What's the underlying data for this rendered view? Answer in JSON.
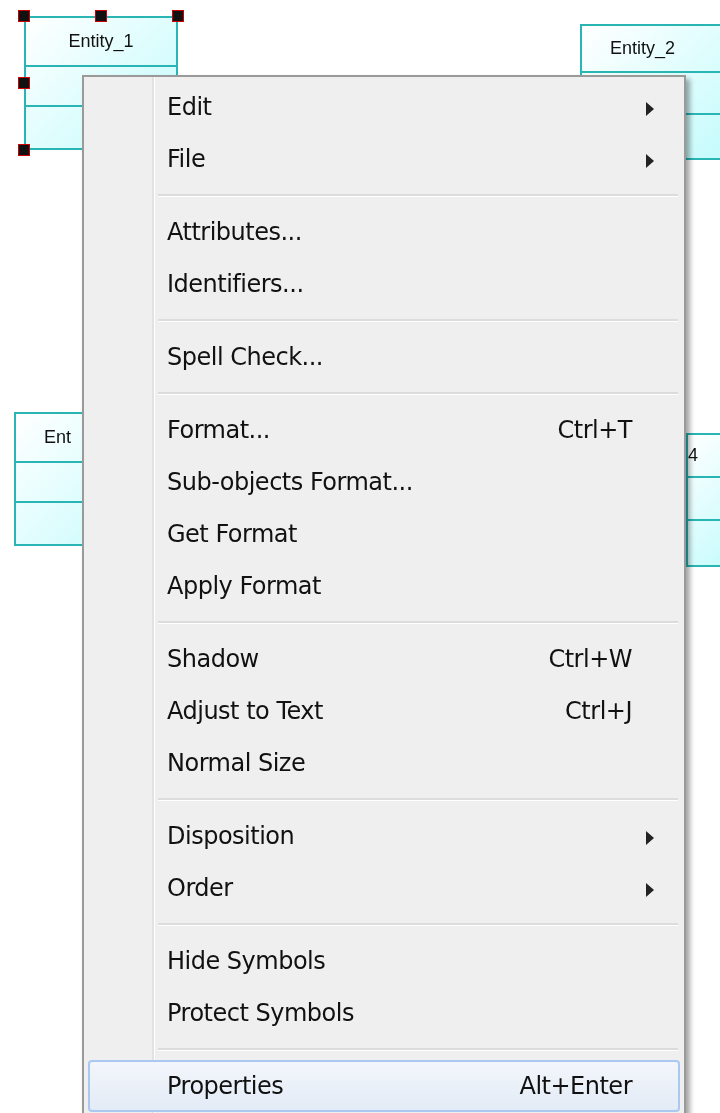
{
  "entities": [
    {
      "name": "Entity_1",
      "selected": true
    },
    {
      "name": "Entity_2",
      "selected": false
    },
    {
      "name": "Ent",
      "selected": false
    },
    {
      "name": "4",
      "selected": false
    }
  ],
  "context_menu": {
    "groups": [
      [
        {
          "label": "Edit",
          "submenu": true,
          "selected": false
        },
        {
          "label": "File",
          "submenu": true,
          "selected": false
        }
      ],
      [
        {
          "label": "Attributes...",
          "submenu": false,
          "selected": false
        },
        {
          "label": "Identifiers...",
          "submenu": false,
          "selected": false
        }
      ],
      [
        {
          "label": "Spell Check...",
          "submenu": false,
          "selected": false
        }
      ],
      [
        {
          "label": "Format...",
          "shortcut": "Ctrl+T",
          "submenu": false,
          "selected": false
        },
        {
          "label": "Sub-objects Format...",
          "submenu": false,
          "selected": false
        },
        {
          "label": "Get Format",
          "submenu": false,
          "selected": false
        },
        {
          "label": "Apply Format",
          "submenu": false,
          "selected": false
        }
      ],
      [
        {
          "label": "Shadow",
          "shortcut": "Ctrl+W",
          "submenu": false,
          "selected": false
        },
        {
          "label": "Adjust to Text",
          "shortcut": "Ctrl+J",
          "submenu": false,
          "selected": false
        },
        {
          "label": "Normal Size",
          "submenu": false,
          "selected": false
        }
      ],
      [
        {
          "label": "Disposition",
          "submenu": true,
          "selected": false
        },
        {
          "label": "Order",
          "submenu": true,
          "selected": false
        }
      ],
      [
        {
          "label": "Hide Symbols",
          "submenu": false,
          "selected": false
        },
        {
          "label": "Protect Symbols",
          "submenu": false,
          "selected": false
        }
      ],
      [
        {
          "label": "Properties",
          "shortcut": "Alt+Enter",
          "submenu": false,
          "selected": true
        }
      ]
    ]
  }
}
